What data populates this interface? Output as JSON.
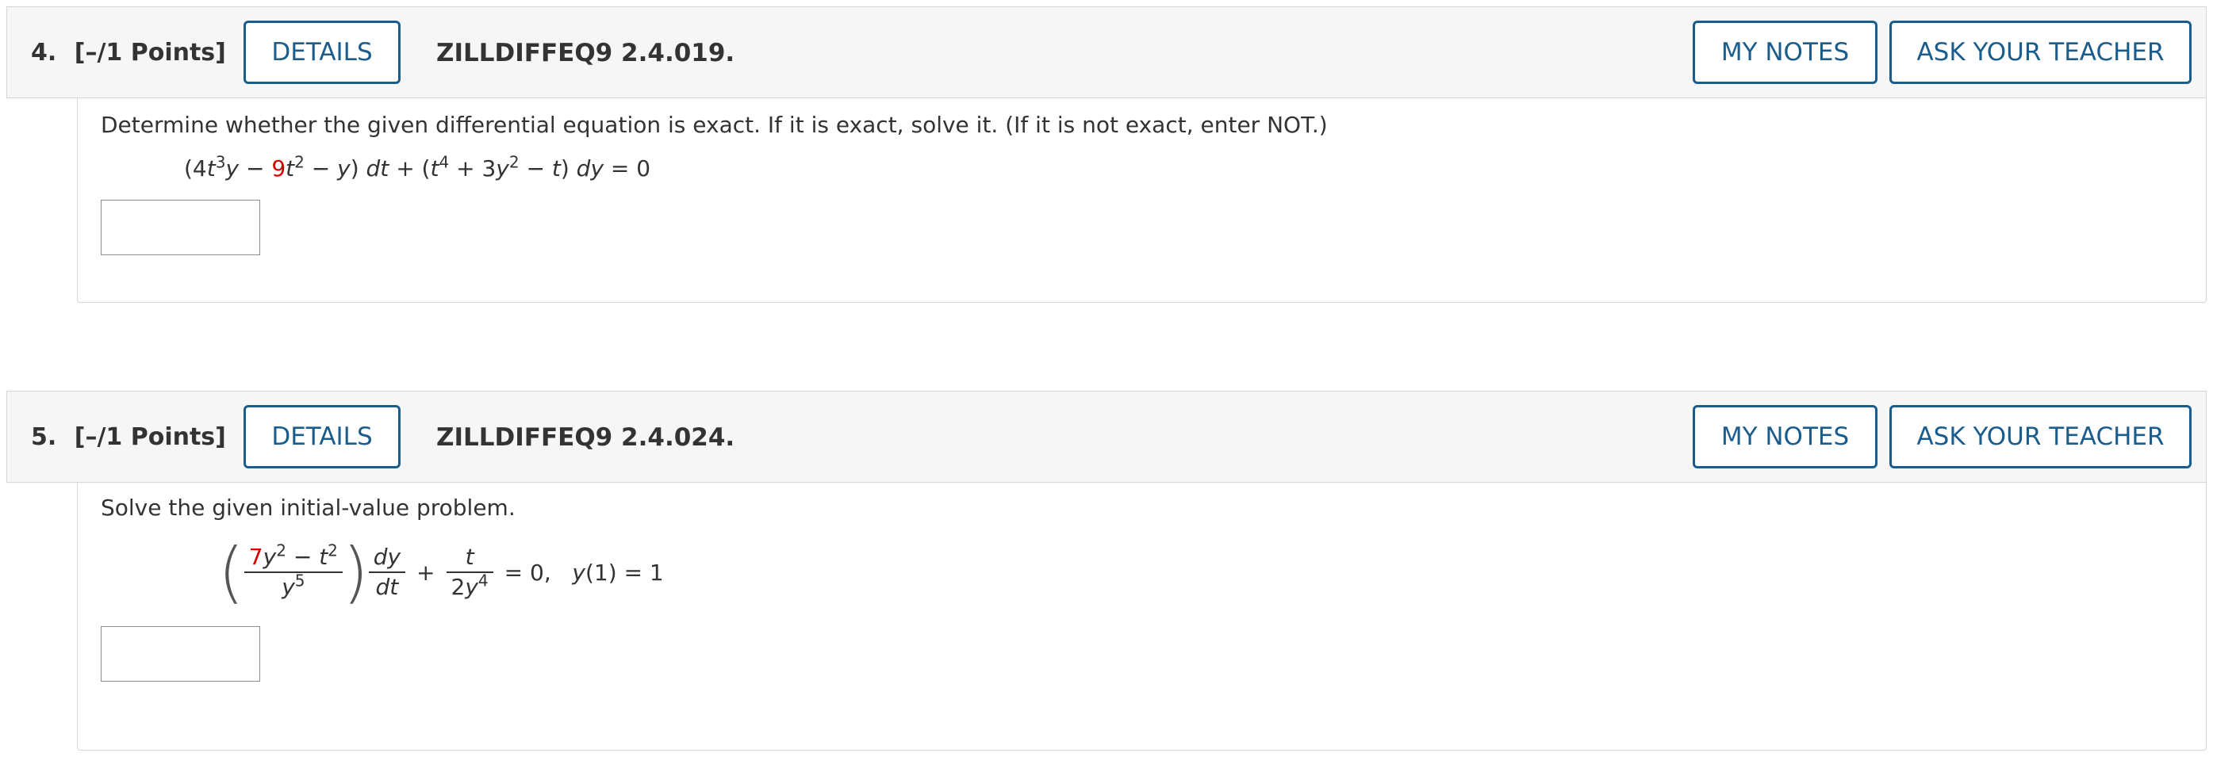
{
  "questions": [
    {
      "number": "4.",
      "points": "[–/1 Points]",
      "details_label": "DETAILS",
      "code": "ZILLDIFFEQ9 2.4.019.",
      "my_notes_label": "MY NOTES",
      "ask_teacher_label": "ASK YOUR TEACHER",
      "prompt": "Determine whether the given differential equation is exact. If it is exact, solve it. (If it is not exact, enter NOT.)",
      "answer_value": ""
    },
    {
      "number": "5.",
      "points": "[–/1 Points]",
      "details_label": "DETAILS",
      "code": "ZILLDIFFEQ9 2.4.024.",
      "my_notes_label": "MY NOTES",
      "ask_teacher_label": "ASK YOUR TEACHER",
      "prompt": "Solve the given initial-value problem.",
      "answer_value": ""
    }
  ],
  "colors": {
    "accent": "#1a5d8c",
    "highlight": "#d40000"
  }
}
